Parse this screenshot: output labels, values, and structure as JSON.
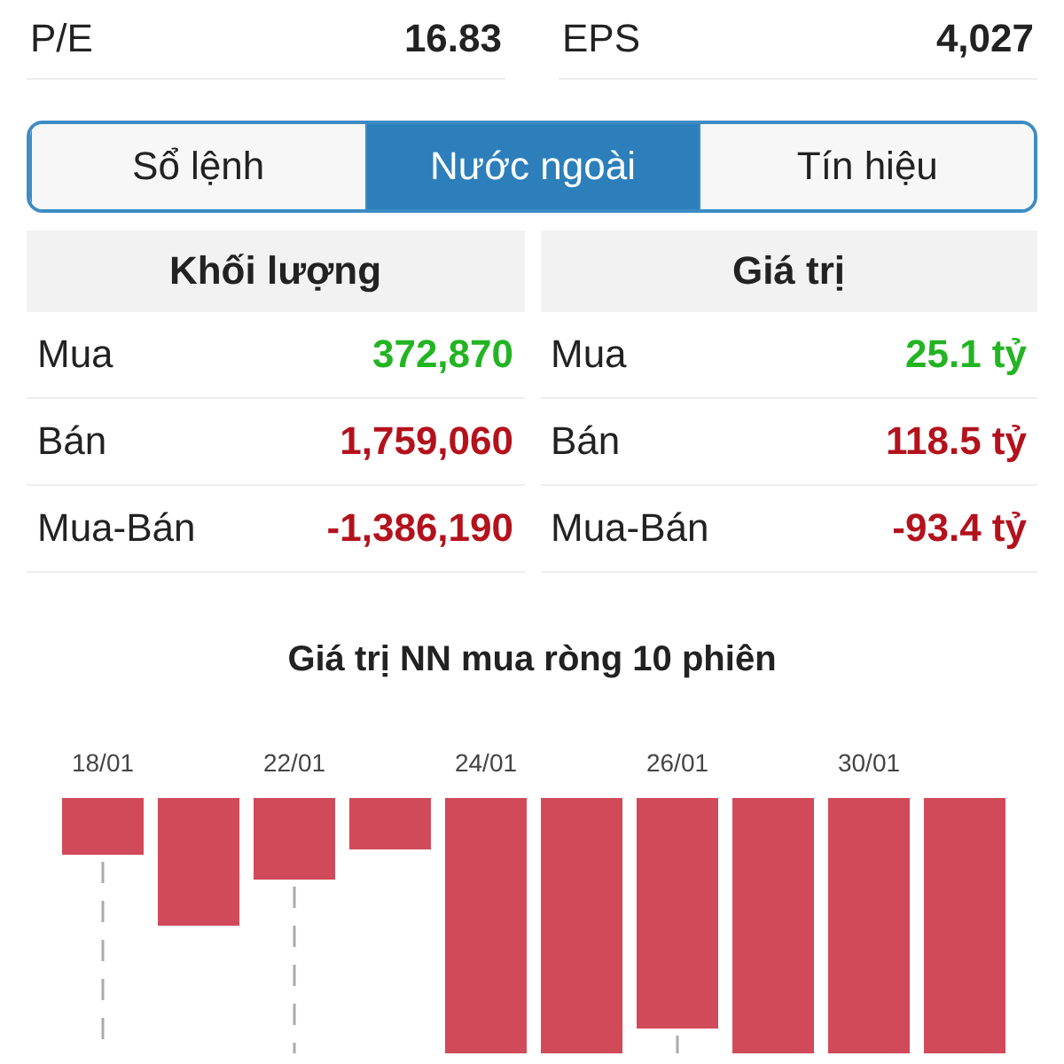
{
  "stats": [
    {
      "label": "P/E",
      "value": "16.83"
    },
    {
      "label": "EPS",
      "value": "4,027"
    }
  ],
  "tabs": [
    {
      "label": "Sổ lệnh",
      "selected": false
    },
    {
      "label": "Nước ngoài",
      "selected": true
    },
    {
      "label": "Tín hiệu",
      "selected": false
    }
  ],
  "tables": [
    {
      "title": "Khối lượng",
      "rows": [
        {
          "label": "Mua",
          "value": "372,870",
          "color": "#22b422"
        },
        {
          "label": "Bán",
          "value": "1,759,060",
          "color": "#b3121c"
        },
        {
          "label": "Mua-Bán",
          "value": "-1,386,190",
          "color": "#b3121c"
        }
      ]
    },
    {
      "title": "Giá trị",
      "rows": [
        {
          "label": "Mua",
          "value": "25.1 tỷ",
          "color": "#22b422"
        },
        {
          "label": "Bán",
          "value": "118.5 tỷ",
          "color": "#b3121c"
        },
        {
          "label": "Mua-Bán",
          "value": "-93.4 tỷ",
          "color": "#b3121c"
        }
      ]
    }
  ],
  "chart": {
    "title": "Giá trị NN mua ròng 10 phiên",
    "date_labels": [
      "18/01",
      "22/01",
      "24/01",
      "26/01",
      "30/01"
    ]
  }
}
